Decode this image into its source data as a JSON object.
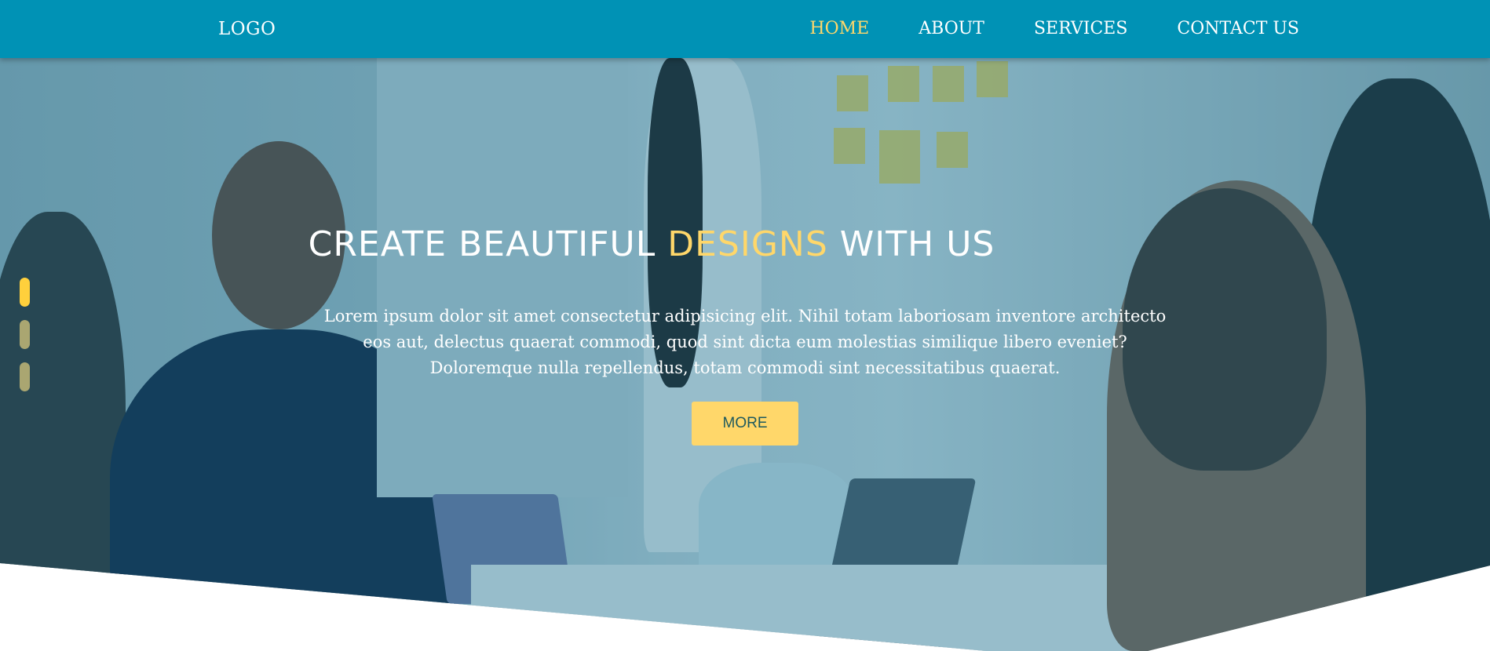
{
  "nav": {
    "logo": "LOGO",
    "items": [
      {
        "label": "HOME",
        "active": true
      },
      {
        "label": "ABOUT",
        "active": false
      },
      {
        "label": "SERVICES",
        "active": false
      },
      {
        "label": "CONTACT US",
        "active": false
      }
    ]
  },
  "hero": {
    "title_part1": "CREATE BEAUTIFUL ",
    "title_accent": "DESIGNS",
    "title_part2": " WITH US",
    "lead": "Lorem ipsum dolor sit amet consectetur adipisicing elit. Nihil totam laboriosam inventore architecto eos aut, delectus quaerat commodi, quod sint dicta eum molestias similique libero eveniet? Doloremque nulla repellendus, totam commodi sint necessitatibus quaerat.",
    "button_label": "MORE"
  },
  "slider": {
    "dot_count": 3,
    "active_index": 0
  },
  "colors": {
    "nav": "#0092b5",
    "accent": "#ffd76a"
  }
}
